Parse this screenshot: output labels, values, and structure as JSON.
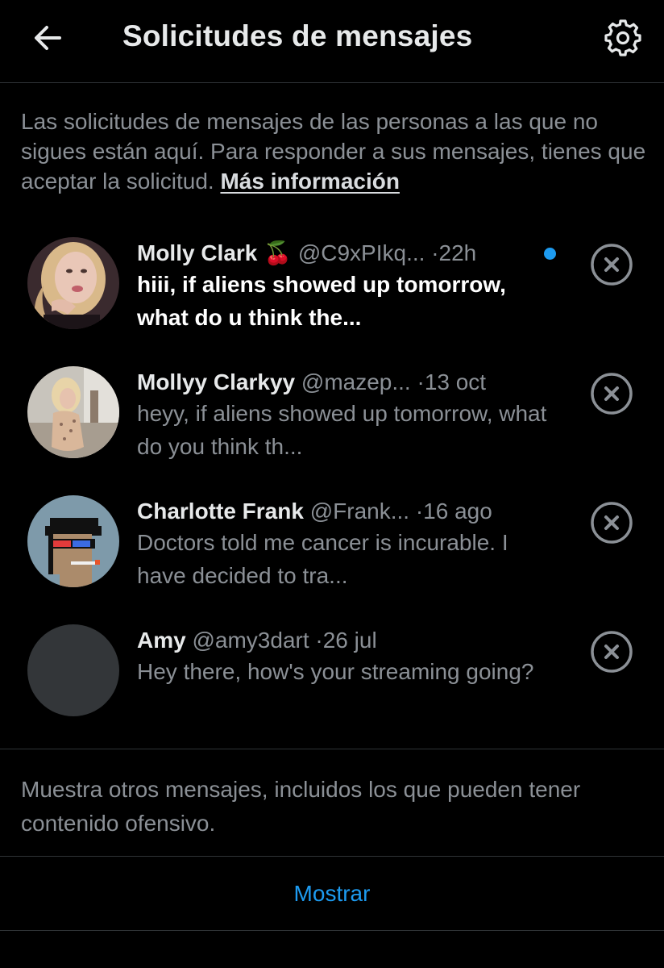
{
  "header": {
    "title": "Solicitudes de mensajes",
    "back_icon": "arrow-left-icon",
    "settings_icon": "gear-icon"
  },
  "intro": {
    "text": "Las solicitudes de mensajes de las personas a las que no sigues están aquí. Para responder a sus mensajes, tienes que aceptar la solicitud.",
    "link": "Más información"
  },
  "requests": [
    {
      "name": "Molly Clark",
      "emoji": "🍒",
      "handle": "@C9xPIkq...",
      "time": "22h",
      "message": "hiii, if aliens showed up tomorrow, what do u think the...",
      "unread": true
    },
    {
      "name": "Mollyy Clarkyy",
      "handle": "@mazep...",
      "time": "13 oct",
      "message": "heyy, if aliens showed up tomorrow, what do you think th...",
      "unread": false
    },
    {
      "name": "Charlotte Frank",
      "handle": "@Frank...",
      "time": "16 ago",
      "message": "Doctors told me cancer is incurable. I have decided to tra...",
      "unread": false
    },
    {
      "name": "Amy",
      "handle": "@amy3dart",
      "time": "26 jul",
      "message": "Hey there, how's your streaming going?",
      "unread": false
    }
  ],
  "separator": "·",
  "footer": {
    "text": "Muestra otros mensajes, incluidos los que pueden tener contenido ofensivo.",
    "button": "Mostrar"
  },
  "colors": {
    "background": "#000000",
    "text": "#e7e9ea",
    "muted": "#8b9096",
    "accent": "#1d9bf0",
    "divider": "#2f3336"
  }
}
